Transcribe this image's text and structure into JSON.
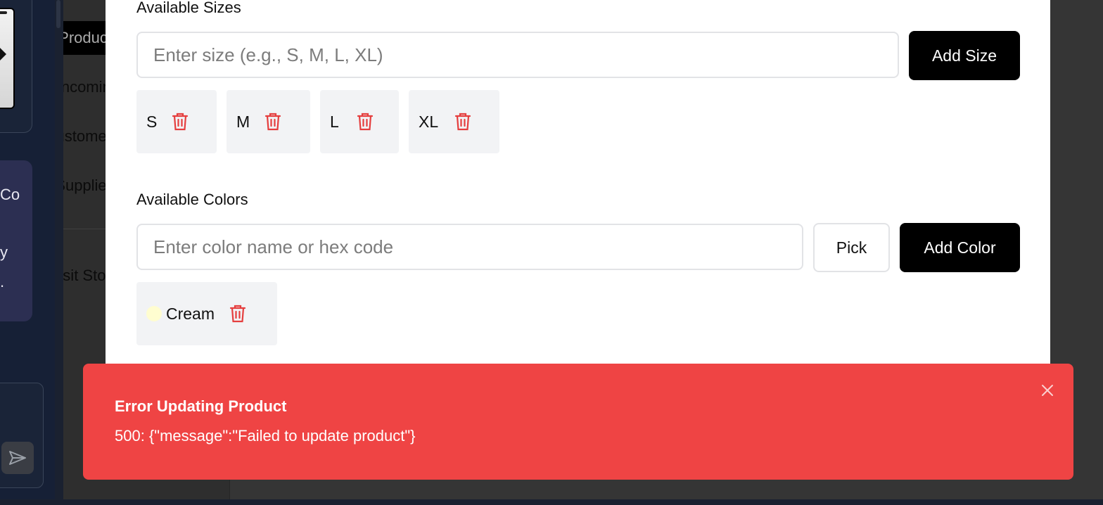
{
  "sidebar": {
    "items": [
      {
        "label": "Products"
      },
      {
        "label": "Incoming"
      },
      {
        "label": "Customers"
      },
      {
        "label": "Suppliers"
      },
      {
        "label": "Visit Store"
      }
    ]
  },
  "promo": {
    "line1": "Co",
    "line2": "y",
    "line3": "."
  },
  "sizes": {
    "label": "Available Sizes",
    "input_placeholder": "Enter size (e.g., S, M, L, XL)",
    "add_button": "Add Size",
    "items": [
      {
        "label": "S"
      },
      {
        "label": "M"
      },
      {
        "label": "L"
      },
      {
        "label": "XL"
      }
    ]
  },
  "colors": {
    "label": "Available Colors",
    "input_placeholder": "Enter color name or hex code",
    "pick_button": "Pick",
    "add_button": "Add Color",
    "items": [
      {
        "label": "Cream",
        "swatch": "#fffdd0"
      }
    ]
  },
  "toast": {
    "title": "Error Updating Product",
    "message": "500: {\"message\":\"Failed to update product\"}",
    "background": "#ef4444"
  },
  "icons": {
    "trash": "trash-icon",
    "close": "close-icon",
    "send": "send-icon"
  }
}
